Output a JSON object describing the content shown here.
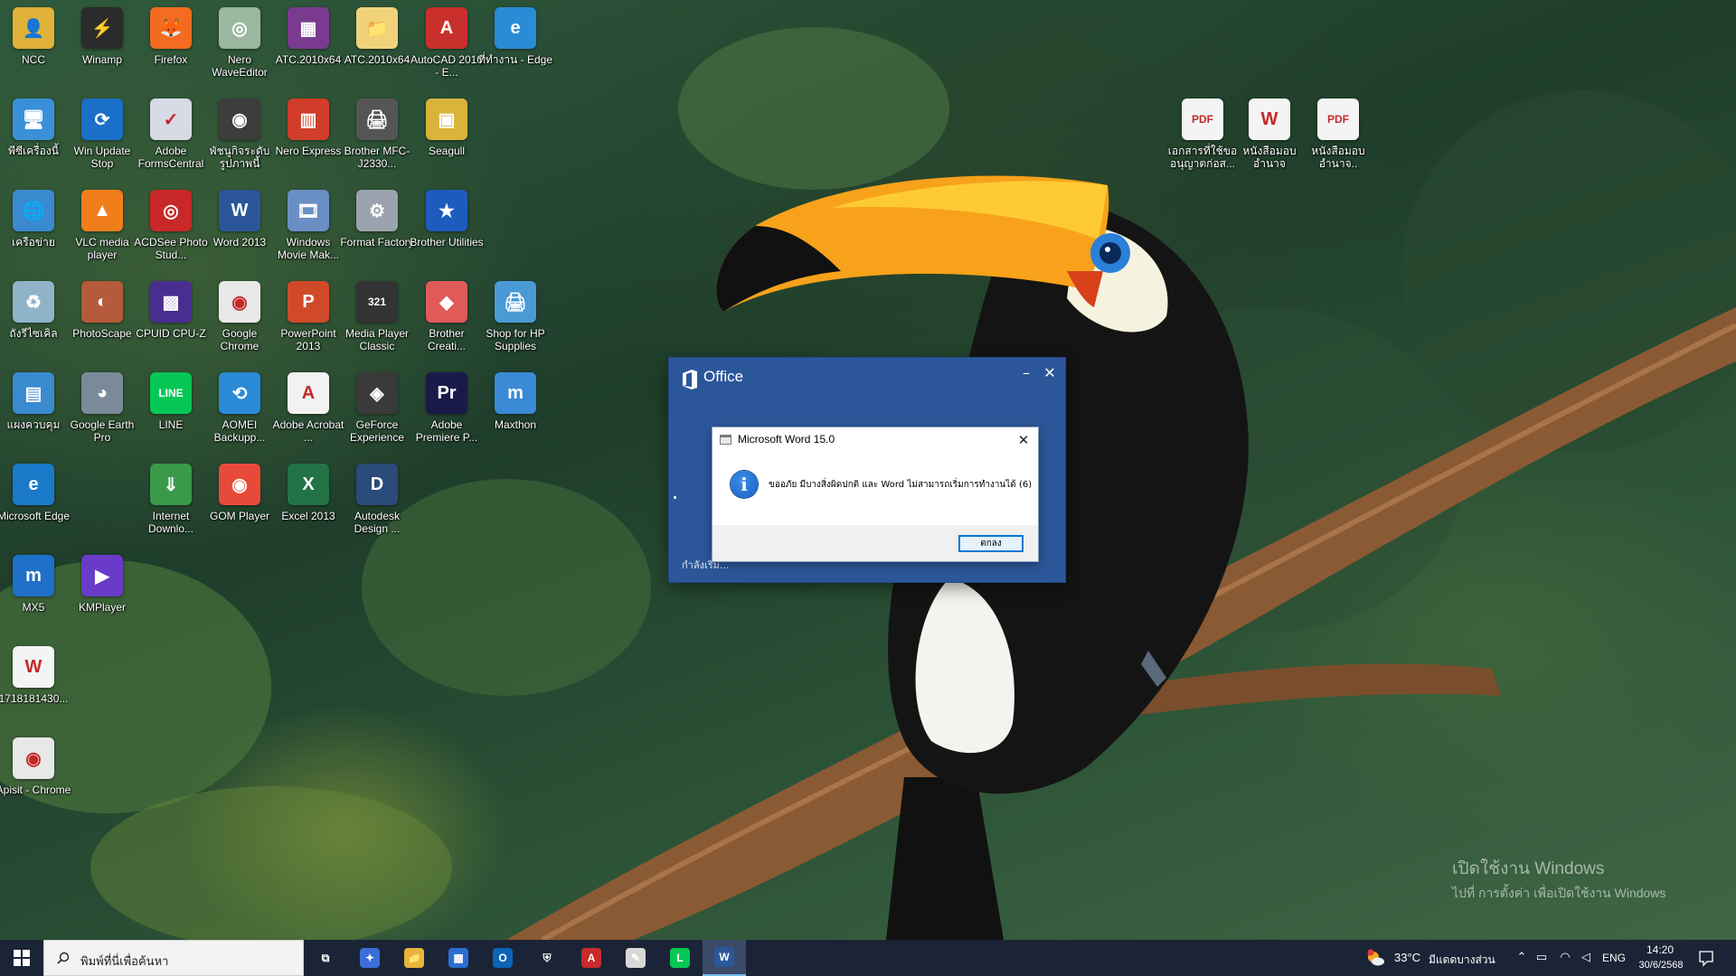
{
  "desktop": {
    "icons": [
      {
        "label": "NCC",
        "color": "#e0b23a",
        "glyph": "👤"
      },
      {
        "label": "Winamp",
        "color": "#2b2b2b",
        "glyph": "⚡"
      },
      {
        "label": "Firefox",
        "color": "#f26b21",
        "glyph": "🦊"
      },
      {
        "label": "Nero WaveEditor",
        "color": "#9ab9a0",
        "glyph": "◎"
      },
      {
        "label": "ATC.2010x64",
        "color": "#7a3b8f",
        "glyph": "▦"
      },
      {
        "label": "ATC.2010x64",
        "color": "#f0d27a",
        "glyph": "📁"
      },
      {
        "label": "AutoCAD 2010 - E...",
        "color": "#c9302c",
        "glyph": "A"
      },
      {
        "label": "ที่ทำงาน - Edge",
        "color": "#2a8bd6",
        "glyph": "e"
      },
      {
        "label": "พีซีเครื่องนี้",
        "color": "#3a90d8",
        "glyph": "🖥"
      },
      {
        "label": "Win Update Stop",
        "color": "#1a6fc9",
        "glyph": "⟳"
      },
      {
        "label": "Adobe FormsCentral",
        "color": "#d6dbe5",
        "glyph": "✓"
      },
      {
        "label": "พัชนูกิจระดับ รูปภาพนี้",
        "color": "#3d3d3d",
        "glyph": "◉"
      },
      {
        "label": "Nero Express",
        "color": "#d13d2a",
        "glyph": "▥"
      },
      {
        "label": "Brother MFC-J2330...",
        "color": "#555555",
        "glyph": "🖨"
      },
      {
        "label": "Seagull",
        "color": "#d8b43a",
        "glyph": "▣"
      },
      {
        "label": "เครือข่าย",
        "color": "#3a8ad0",
        "glyph": "🌐"
      },
      {
        "label": "VLC media player",
        "color": "#f07f1b",
        "glyph": "▲"
      },
      {
        "label": "ACDSee Photo Stud...",
        "color": "#c82828",
        "glyph": "◎"
      },
      {
        "label": "Word 2013",
        "color": "#2b579a",
        "glyph": "W"
      },
      {
        "label": "Windows Movie Mak...",
        "color": "#6a8fc4",
        "glyph": "🎞"
      },
      {
        "label": "Format Factory",
        "color": "#9aa3ad",
        "glyph": "⚙"
      },
      {
        "label": "Brother Utilities",
        "color": "#1e5bbf",
        "glyph": "★"
      },
      {
        "label": "ถังรีไซเคิล",
        "color": "#8fb3c9",
        "glyph": "♻"
      },
      {
        "label": "PhotoScape",
        "color": "#b55a3a",
        "glyph": "◐"
      },
      {
        "label": "CPUID CPU-Z",
        "color": "#4a2e8f",
        "glyph": "▩"
      },
      {
        "label": "Google Chrome",
        "color": "#e8e8e8",
        "glyph": "◉"
      },
      {
        "label": "PowerPoint 2013",
        "color": "#d04a2a",
        "glyph": "P"
      },
      {
        "label": "Media Player Classic",
        "color": "#333333",
        "glyph": "321"
      },
      {
        "label": "Brother Creati...",
        "color": "#e05a5a",
        "glyph": "◆"
      },
      {
        "label": "Shop for HP Supplies",
        "color": "#4a9ad6",
        "glyph": "🖨"
      },
      {
        "label": "แผงควบคุม",
        "color": "#3a8ad0",
        "glyph": "▤"
      },
      {
        "label": "Google Earth Pro",
        "color": "#7a8a9a",
        "glyph": "◕"
      },
      {
        "label": "LINE",
        "color": "#06c755",
        "glyph": "LINE"
      },
      {
        "label": "AOMEI Backupp...",
        "color": "#2a8ad6",
        "glyph": "⟲"
      },
      {
        "label": "Adobe Acrobat ...",
        "color": "#f2f2f2",
        "glyph": "A"
      },
      {
        "label": "GeForce Experience",
        "color": "#3a3a3a",
        "glyph": "◈"
      },
      {
        "label": "Adobe Premiere P...",
        "color": "#1a1a4a",
        "glyph": "Pr"
      },
      {
        "label": "Maxthon",
        "color": "#3a8ad6",
        "glyph": "m"
      },
      {
        "label": "Microsoft Edge",
        "color": "#1a7ac9",
        "glyph": "e"
      },
      {
        "label": "Internet Downlo...",
        "color": "#3a9a4a",
        "glyph": "⇓"
      },
      {
        "label": "GOM Player",
        "color": "#e84a3a",
        "glyph": "◉"
      },
      {
        "label": "Excel 2013",
        "color": "#217346",
        "glyph": "X"
      },
      {
        "label": "Autodesk Design ...",
        "color": "#2a4a7a",
        "glyph": "D"
      },
      {
        "label": "MX5",
        "color": "#1e70c8",
        "glyph": "m"
      },
      {
        "label": "KMPlayer",
        "color": "#6a3ac9",
        "glyph": "▶"
      },
      {
        "label": "1718181430...",
        "color": "#f4f4f4",
        "glyph": "W"
      },
      {
        "label": "Apisit - Chrome",
        "color": "#e8e8e8",
        "glyph": "◉"
      },
      {
        "label": "เอกสารที่ใช้ขอ อนุญาตก่อส...",
        "color": "#f4f4f4",
        "glyph": "PDF"
      },
      {
        "label": "หนังสือมอบ อำนาจ",
        "color": "#f4f4f4",
        "glyph": "W"
      },
      {
        "label": "หนังสือมอบ อำนาจ..",
        "color": "#f4f4f4",
        "glyph": "PDF"
      }
    ]
  },
  "office_splash": {
    "title": "Office",
    "minimize_glyph": "–",
    "close_glyph": "✕",
    "status": "กำลังเริ่ม..."
  },
  "message_box": {
    "title": "Microsoft Word 15.0",
    "close_glyph": "✕",
    "info_glyph": "i",
    "message": "ขออภัย มีบางสิ่งผิดปกติ และ Word ไม่สามารถเริ่มการทำงานได้ (6)",
    "ok_label": "ตกลง"
  },
  "activation": {
    "line1": "เปิดใช้งาน Windows",
    "line2": "ไปที่ การตั้งค่า เพื่อเปิดใช้งาน Windows"
  },
  "taskbar": {
    "search_placeholder": "พิมพ์ที่นี่เพื่อค้นหา",
    "apps": [
      {
        "name": "task-view",
        "glyph": "⧉",
        "color": "#1b2436",
        "active": false
      },
      {
        "name": "copilot",
        "glyph": "✦",
        "color": "#3b6fd8",
        "active": false
      },
      {
        "name": "file-explorer",
        "glyph": "📁",
        "color": "#e6b43a",
        "active": false
      },
      {
        "name": "microsoft-store",
        "glyph": "▦",
        "color": "#2a6fd0",
        "active": false
      },
      {
        "name": "outlook",
        "glyph": "O",
        "color": "#0a64b8",
        "active": false
      },
      {
        "name": "security",
        "glyph": "⛨",
        "color": "#1b2436",
        "active": false
      },
      {
        "name": "acrobat",
        "glyph": "A",
        "color": "#c92a2a",
        "active": false
      },
      {
        "name": "document-viewer",
        "glyph": "✎",
        "color": "#d8d8d8",
        "active": false
      },
      {
        "name": "line",
        "glyph": "L",
        "color": "#06c755",
        "active": false
      },
      {
        "name": "word",
        "glyph": "W",
        "color": "#2b579a",
        "active": true
      }
    ],
    "tray": {
      "temperature": "33°C",
      "condition": "มีแดดบางส่วน",
      "language": "ENG",
      "time": "14:20",
      "date": "30/6/2568"
    }
  }
}
